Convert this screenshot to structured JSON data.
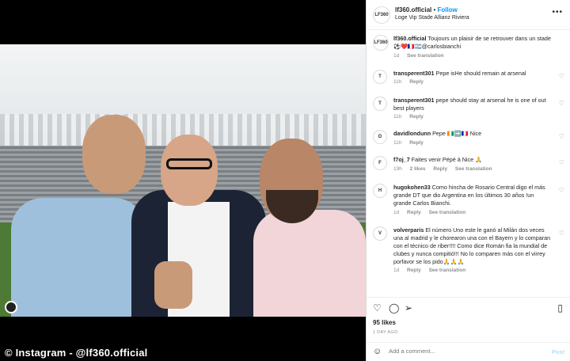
{
  "credit": "© Instagram - @lf360.official",
  "header": {
    "avatar_text": "LF360",
    "username": "lf360.official",
    "dot": "•",
    "follow": "Follow",
    "location": "Loge Vip Stade Allianz Riviera",
    "more": "•••"
  },
  "caption": {
    "username": "lf360.official",
    "text": "Toujours un plaisir de se retrouver dans un stade ⚽❤️🇫🇷🇦🇷@carlosbianchi",
    "time": "1d",
    "translate": "See translation"
  },
  "comments": [
    {
      "avatar": "T",
      "username": "transperent301",
      "text": "Pepe isHe should remain at arsenal",
      "time": "11h",
      "likes": "",
      "reply": "Reply",
      "translate": ""
    },
    {
      "avatar": "T",
      "username": "transperent301",
      "text": "pepe should stay at arsenal he is one of out best players",
      "time": "11h",
      "likes": "",
      "reply": "Reply",
      "translate": ""
    },
    {
      "avatar": "D",
      "username": "davidlondunn",
      "text": "Pepe 🇨🇮➡️🇫🇷 Nice",
      "time": "11h",
      "likes": "",
      "reply": "Reply",
      "translate": ""
    },
    {
      "avatar": "F",
      "username": "f7oj_7",
      "text": "Faites venir Pépé à Nice 🙏",
      "time": "19h",
      "likes": "2 likes",
      "reply": "Reply",
      "translate": "See translation"
    },
    {
      "avatar": "H",
      "username": "hugokohen33",
      "text": "Como hincha de Rosario Central digo el más grande DT que dio Argentina en los últimos 30 años !un grande Carlos Bianchi.",
      "time": "1d",
      "likes": "",
      "reply": "Reply",
      "translate": "See translation"
    },
    {
      "avatar": "V",
      "username": "volverparis",
      "text": "El número Uno este le ganó al Milán dos veces una al madrid y le chorearon una con el Bayern y lo comparan con el técnico de riber!!!! Como dice Román fia la mundial de clubes y nunca compitió!!! No lo comparen más con el virrey porfavor se los pido🙏🙏🙏",
      "time": "1d",
      "likes": "",
      "reply": "Reply",
      "translate": "See translation"
    }
  ],
  "actions": {
    "like": "♡",
    "comment": "◯",
    "share": "➢",
    "save": "▯"
  },
  "likes": "95 likes",
  "date": "1 DAY AGO",
  "add_comment": {
    "emoji": "☺",
    "placeholder": "Add a comment...",
    "post": "Post"
  }
}
